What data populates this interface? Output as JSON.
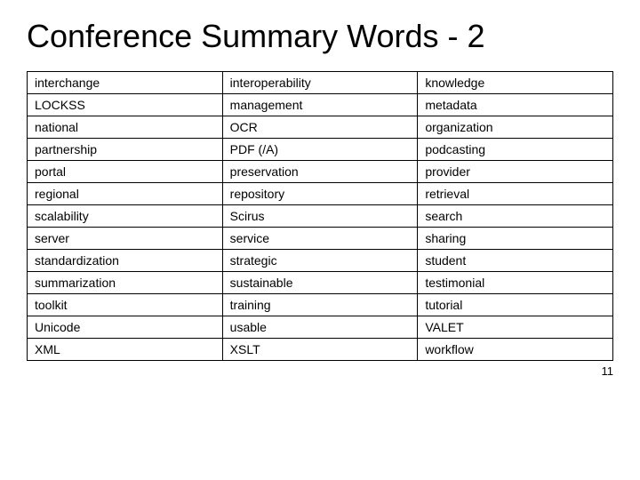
{
  "title": "Conference Summary Words - 2",
  "table": {
    "rows": [
      [
        "interchange",
        "interoperability",
        "knowledge"
      ],
      [
        "LOCKSS",
        "management",
        "metadata"
      ],
      [
        "national",
        "OCR",
        "organization"
      ],
      [
        "partnership",
        "PDF  (/A)",
        "podcasting"
      ],
      [
        "portal",
        "preservation",
        "provider"
      ],
      [
        "regional",
        "repository",
        "retrieval"
      ],
      [
        "scalability",
        "Scirus",
        "search"
      ],
      [
        "server",
        "service",
        "sharing"
      ],
      [
        "standardization",
        "strategic",
        "student"
      ],
      [
        "summarization",
        "sustainable",
        "testimonial"
      ],
      [
        "toolkit",
        "training",
        "tutorial"
      ],
      [
        "Unicode",
        "usable",
        "VALET"
      ],
      [
        "XML",
        "XSLT",
        "workflow"
      ]
    ]
  },
  "page_number": "11"
}
